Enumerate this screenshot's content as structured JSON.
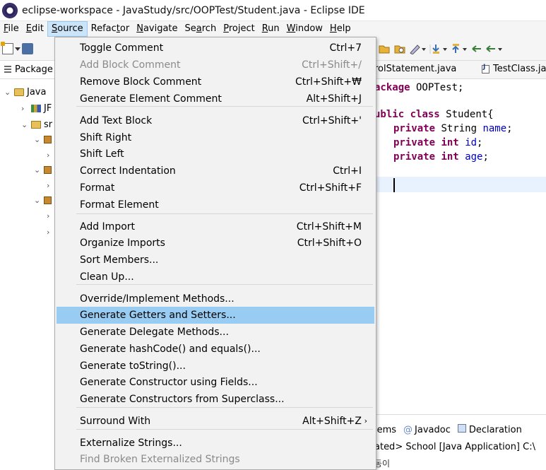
{
  "window": {
    "title": "eclipse-workspace - JavaStudy/src/OOPTest/Student.java - Eclipse IDE"
  },
  "menubar": [
    {
      "label": "File",
      "mnemonic": "F",
      "rest": "ile"
    },
    {
      "label": "Edit",
      "mnemonic": "E",
      "rest": "dit"
    },
    {
      "label": "Source",
      "mnemonic": "S",
      "rest": "ource",
      "active": true
    },
    {
      "label": "Refactor",
      "pre": "Refac",
      "mnemonic": "t",
      "rest": "or"
    },
    {
      "label": "Navigate",
      "mnemonic": "N",
      "rest": "avigate"
    },
    {
      "label": "Search",
      "pre": "Se",
      "mnemonic": "a",
      "rest": "rch"
    },
    {
      "label": "Project",
      "mnemonic": "P",
      "rest": "roject"
    },
    {
      "label": "Run",
      "mnemonic": "R",
      "rest": "un"
    },
    {
      "label": "Window",
      "mnemonic": "W",
      "rest": "indow"
    },
    {
      "label": "Help",
      "mnemonic": "H",
      "rest": "elp"
    }
  ],
  "explorer": {
    "tab_label": "Package",
    "project_label": "Java",
    "jre_label": "JF",
    "src_label": "sr"
  },
  "editor": {
    "tab1_label": "rolStatement.java",
    "tab2_label": "TestClass.ja",
    "code": {
      "line1_kw": "ackage",
      "line1_rest": " OOPTest;",
      "line2_kw1": "ublic",
      "line2_kw2": "class",
      "line2_rest": " Student{",
      "line3_kw": "private",
      "line3_type": " String ",
      "line3_field": "name",
      "line4_kw1": "private",
      "line4_kw2": "int",
      "line4_field": "id",
      "line5_kw1": "private",
      "line5_kw2": "int",
      "line5_field": "age"
    }
  },
  "bottom": {
    "tab_problems": "lems",
    "tab_javadoc": "Javadoc",
    "tab_declaration": "Declaration",
    "console_text": "ated> School [Java Application] C:\\",
    "status_text": "동이"
  },
  "source_menu": {
    "items": [
      {
        "label": "Toggle Comment",
        "accel": "Ctrl+7",
        "disabled": false
      },
      {
        "label": "Add Block Comment",
        "accel": "Ctrl+Shift+/",
        "disabled": true
      },
      {
        "label": "Remove Block Comment",
        "accel": "Ctrl+Shift+₩",
        "disabled": false
      },
      {
        "label": "Generate Element Comment",
        "accel": "Alt+Shift+J",
        "disabled": false
      },
      {
        "label": "Add Text Block",
        "accel": "Ctrl+Shift+'",
        "disabled": false
      },
      {
        "label": "Shift Right",
        "accel": "",
        "disabled": false
      },
      {
        "label": "Shift Left",
        "accel": "",
        "disabled": false
      },
      {
        "label": "Correct Indentation",
        "accel": "Ctrl+I",
        "disabled": false
      },
      {
        "label": "Format",
        "accel": "Ctrl+Shift+F",
        "disabled": false
      },
      {
        "label": "Format Element",
        "accel": "",
        "disabled": false
      },
      {
        "label": "Add Import",
        "accel": "Ctrl+Shift+M",
        "disabled": false
      },
      {
        "label": "Organize Imports",
        "accel": "Ctrl+Shift+O",
        "disabled": false
      },
      {
        "label": "Sort Members...",
        "accel": "",
        "disabled": false
      },
      {
        "label": "Clean Up...",
        "accel": "",
        "disabled": false
      },
      {
        "label": "Override/Implement Methods...",
        "accel": "",
        "disabled": false
      },
      {
        "label": "Generate Getters and Setters...",
        "accel": "",
        "disabled": false,
        "highlighted": true
      },
      {
        "label": "Generate Delegate Methods...",
        "accel": "",
        "disabled": false
      },
      {
        "label": "Generate hashCode() and equals()...",
        "accel": "",
        "disabled": false
      },
      {
        "label": "Generate toString()...",
        "accel": "",
        "disabled": false
      },
      {
        "label": "Generate Constructor using Fields...",
        "accel": "",
        "disabled": false
      },
      {
        "label": "Generate Constructors from Superclass...",
        "accel": "",
        "disabled": false
      },
      {
        "label": "Surround With",
        "accel": "Alt+Shift+Z",
        "disabled": false,
        "submenu": true
      },
      {
        "label": "Externalize Strings...",
        "accel": "",
        "disabled": false
      },
      {
        "label": "Find Broken Externalized Strings",
        "accel": "",
        "disabled": true
      }
    ],
    "submenu_arrow": "›"
  }
}
